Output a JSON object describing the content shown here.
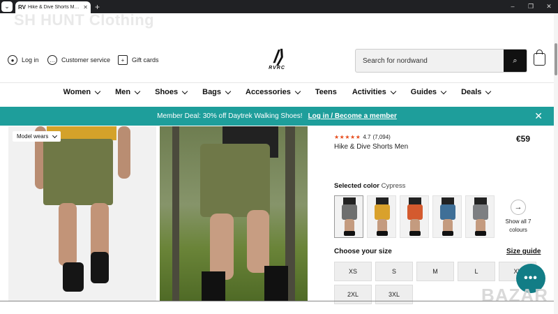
{
  "browser": {
    "tab_title": "Hike & Dive Shorts Men Black",
    "favicon": "RV",
    "new_tab": "+",
    "controls": [
      "–",
      "❐",
      "✕"
    ]
  },
  "watermark_top": "SH HUNT Clothing",
  "header": {
    "login": "Log in",
    "customer_service": "Customer service",
    "gift_cards": "Gift cards",
    "logo_text": "RVRC",
    "search_placeholder": "Search for nordwand"
  },
  "nav": {
    "items": [
      "Women",
      "Men",
      "Shoes",
      "Bags",
      "Accessories",
      "Teens",
      "Activities",
      "Guides",
      "Deals"
    ]
  },
  "banner": {
    "text": "Member Deal: 30% off Daytrek Walking Shoes!",
    "link": "Log in / Become a member"
  },
  "gallery": {
    "badge": "Model wears"
  },
  "product": {
    "rating": "4.7",
    "review_count": "(7,094)",
    "name": "Hike & Dive Shorts Men",
    "price": "€59",
    "selected_color_label": "Selected color",
    "selected_color": "Cypress",
    "show_all_line1": "Show all 7",
    "show_all_line2": "colours",
    "size_label": "Choose your size",
    "size_guide": "Size guide",
    "sizes": [
      "XS",
      "S",
      "M",
      "L",
      "XL",
      "2XL",
      "3XL"
    ]
  },
  "swatch_colors": [
    "#6e6f6f",
    "#d9a12c",
    "#d45a2e",
    "#3f6f97",
    "#7d7f82"
  ],
  "colors": {
    "banner": "#1e9e9b",
    "chat": "#127d86",
    "stars": "#e74c1c"
  },
  "watermark_bottom": "BAZAR"
}
